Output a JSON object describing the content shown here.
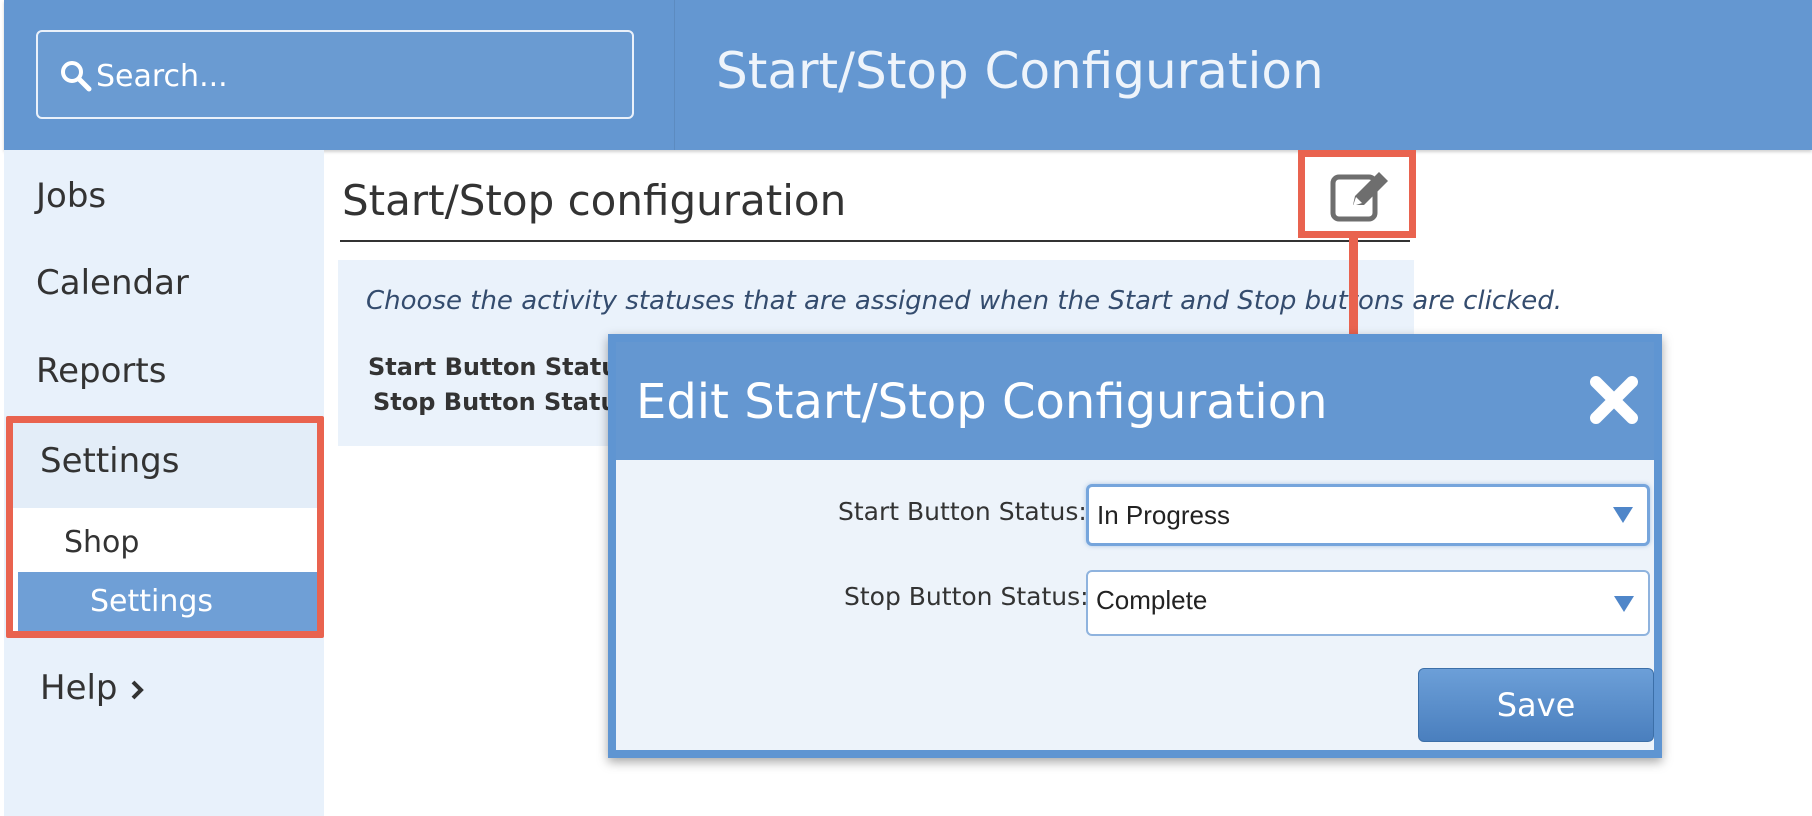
{
  "header": {
    "search_placeholder": "Search...",
    "title": "Start/Stop Configuration"
  },
  "sidebar": {
    "items": [
      {
        "label": "Jobs"
      },
      {
        "label": "Calendar"
      },
      {
        "label": "Reports"
      },
      {
        "label": "Settings"
      },
      {
        "label": "Shop"
      },
      {
        "label": "Settings"
      },
      {
        "label": "Help"
      }
    ],
    "active_item": "Settings"
  },
  "main": {
    "section_title": "Start/Stop configuration",
    "description": "Choose the activity statuses that are assigned when the Start and Stop buttons are clicked.",
    "start_label": "Start Button Status:",
    "stop_label": "Stop Button Status:"
  },
  "modal": {
    "title": "Edit Start/Stop Configuration",
    "start_label": "Start Button Status:",
    "start_value": "In Progress",
    "stop_label": "Stop Button Status:",
    "stop_value": "Complete",
    "save_label": "Save"
  },
  "colors": {
    "brand_blue": "#6497d1",
    "highlight_red": "#e9634f",
    "sidebar_bg": "#e8f1fb",
    "active_item_bg": "#6f9fd6"
  },
  "icons": {
    "search": "search-icon",
    "edit": "edit-icon",
    "close": "close-icon",
    "help_chevron": "chevron-right-icon",
    "select_arrow": "chevron-down-icon"
  }
}
